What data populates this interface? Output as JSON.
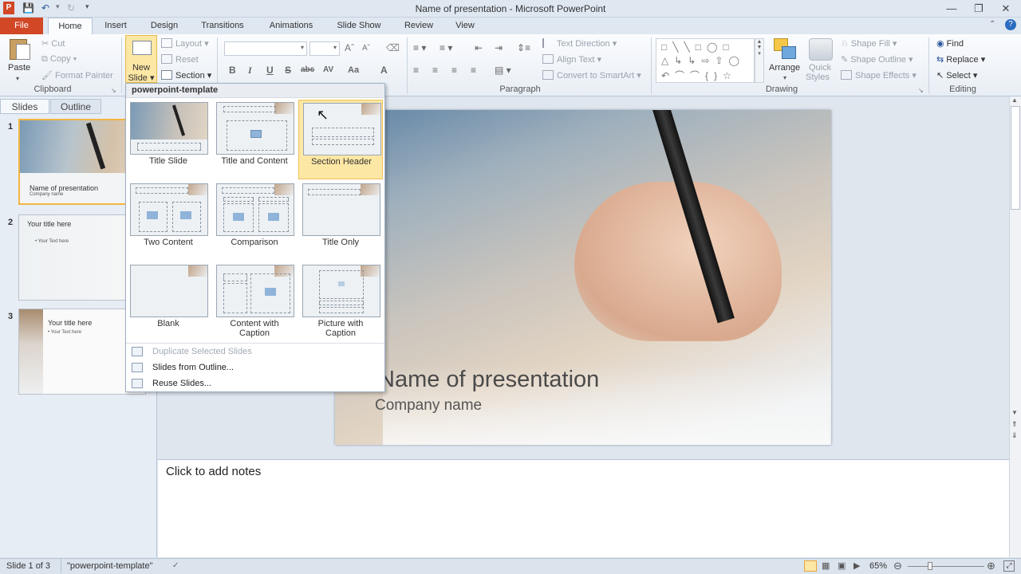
{
  "window": {
    "title": "Name of presentation  -  Microsoft PowerPoint"
  },
  "tabs": [
    "File",
    "Home",
    "Insert",
    "Design",
    "Transitions",
    "Animations",
    "Slide Show",
    "Review",
    "View"
  ],
  "clipboard": {
    "paste": "Paste",
    "cut": "Cut",
    "copy": "Copy",
    "format_painter": "Format Painter",
    "group": "Clipboard"
  },
  "slides": {
    "new_slide_line1": "New",
    "new_slide_line2": "Slide",
    "layout": "Layout",
    "reset": "Reset",
    "section": "Section"
  },
  "font_buttons": [
    "B",
    "I",
    "U",
    "S",
    "abc",
    "AV",
    "Aa",
    "A"
  ],
  "paragraph": {
    "text_direction": "Text Direction",
    "align_text": "Align Text",
    "convert": "Convert to SmartArt",
    "group": "Paragraph"
  },
  "drawing": {
    "arrange": "Arrange",
    "quick_styles_1": "Quick",
    "quick_styles_2": "Styles",
    "shape_fill": "Shape Fill",
    "shape_outline": "Shape Outline",
    "shape_effects": "Shape Effects",
    "group": "Drawing"
  },
  "editing": {
    "find": "Find",
    "replace": "Replace",
    "select": "Select",
    "group": "Editing"
  },
  "pane_tabs": {
    "slides": "Slides",
    "outline": "Outline"
  },
  "thumbnails": [
    {
      "num": "1",
      "title": "Name of presentation",
      "sub": "Company name"
    },
    {
      "num": "2",
      "title": "Your title here",
      "sub": "Your Text here"
    },
    {
      "num": "3",
      "title": "Your title here",
      "sub": "Your Text here"
    }
  ],
  "layout_menu": {
    "header": "powerpoint-template",
    "layouts": [
      "Title Slide",
      "Title and Content",
      "Section Header",
      "Two Content",
      "Comparison",
      "Title Only",
      "Blank",
      "Content with Caption",
      "Picture with Caption"
    ],
    "items": [
      {
        "label": "Duplicate Selected Slides",
        "disabled": true
      },
      {
        "label": "Slides from Outline...",
        "disabled": false
      },
      {
        "label": "Reuse Slides...",
        "disabled": false
      }
    ]
  },
  "slide": {
    "title": "Name of presentation",
    "subtitle": "Company name"
  },
  "notes": {
    "placeholder": "Click to add notes"
  },
  "status": {
    "slide_info": "Slide 1 of 3",
    "theme": "\"powerpoint-template\"",
    "zoom": "65%"
  },
  "colors": {
    "file_tab": "#d24726",
    "accent": "#2b579a",
    "hover": "#fde7a4"
  }
}
